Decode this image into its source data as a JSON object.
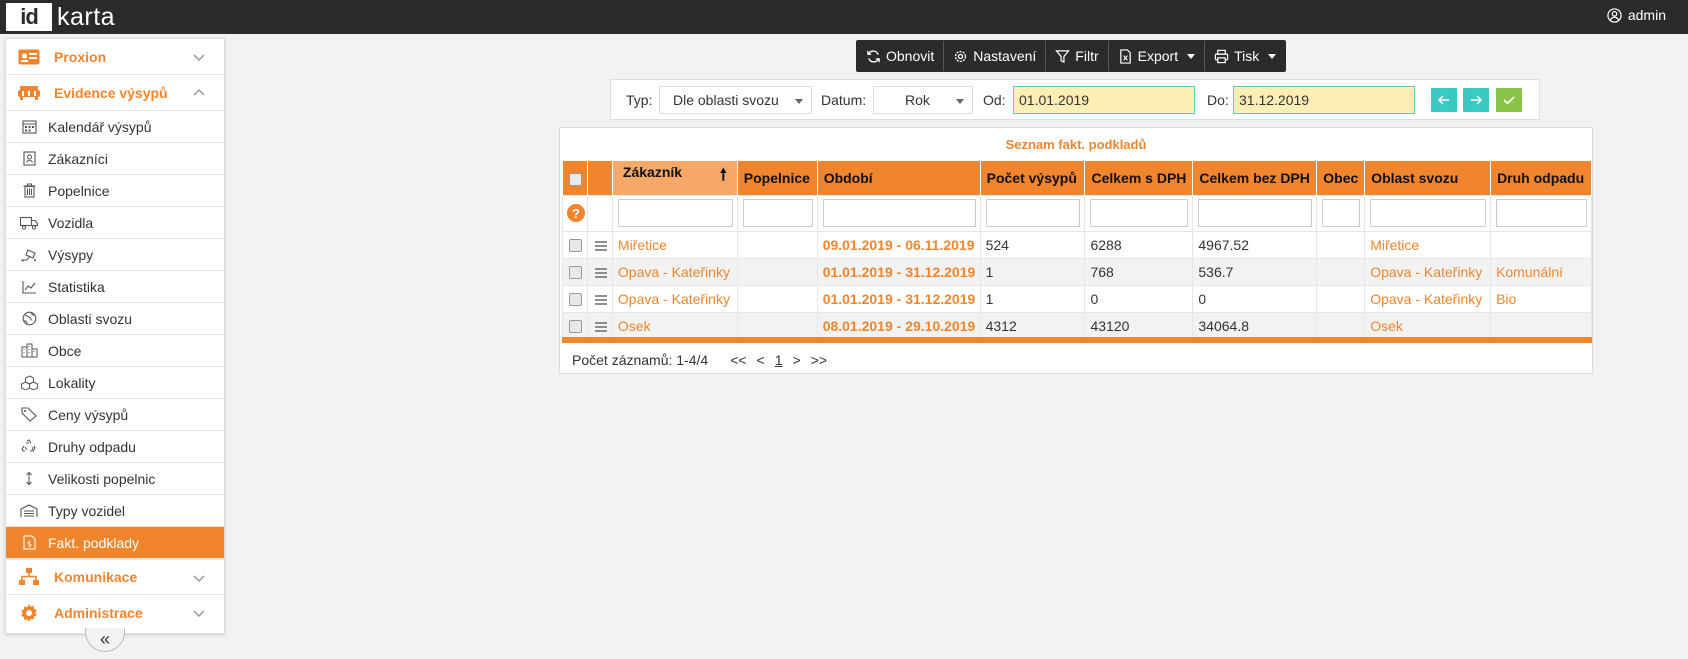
{
  "header": {
    "logo_id": "id",
    "logo_karta": "karta",
    "user_name": "admin"
  },
  "sidebar": {
    "sections": [
      {
        "label": "Proxion",
        "icon": "id-card-icon",
        "expanded": false
      },
      {
        "label": "Evidence výsypů",
        "icon": "sofa-bin-icon",
        "expanded": true
      },
      {
        "label": "Komunikace",
        "icon": "network-icon",
        "expanded": false
      },
      {
        "label": "Administrace",
        "icon": "gear-icon",
        "expanded": false
      }
    ],
    "items": [
      {
        "label": "Kalendář výsypů",
        "icon": "calendar-icon"
      },
      {
        "label": "Zákazníci",
        "icon": "contact-card-icon"
      },
      {
        "label": "Popelnice",
        "icon": "trash-bin-icon"
      },
      {
        "label": "Vozidla",
        "icon": "truck-icon"
      },
      {
        "label": "Výsypy",
        "icon": "dump-icon"
      },
      {
        "label": "Statistika",
        "icon": "chart-line-icon"
      },
      {
        "label": "Oblasti svozu",
        "icon": "globe-icon"
      },
      {
        "label": "Obce",
        "icon": "city-icon"
      },
      {
        "label": "Lokality",
        "icon": "cubes-icon"
      },
      {
        "label": "Ceny výsypů",
        "icon": "tags-icon"
      },
      {
        "label": "Druhy odpadu",
        "icon": "recycle-icon"
      },
      {
        "label": "Velikosti popelnic",
        "icon": "resize-vertical-icon"
      },
      {
        "label": "Typy vozidel",
        "icon": "garage-icon"
      },
      {
        "label": "Fakt. podklady",
        "icon": "invoice-icon",
        "active": true
      }
    ],
    "collapse_label": "«"
  },
  "toolbar": {
    "refresh": "Obnovit",
    "settings": "Nastavení",
    "filter": "Filtr",
    "export": "Export",
    "print": "Tisk"
  },
  "filters": {
    "type_label": "Typ:",
    "type_value": "Dle oblasti svozu",
    "date_label": "Datum:",
    "date_value": "Rok",
    "from_label": "Od:",
    "from_value": "01.01.2019",
    "to_label": "Do:",
    "to_value": "31.12.2019"
  },
  "table": {
    "title": "Seznam fakt. podkladů",
    "columns": [
      "Zákazník",
      "Popelnice",
      "Období",
      "Počet výsypů",
      "Celkem s DPH",
      "Celkem bez DPH",
      "Obec",
      "Oblast svozu",
      "Druh odpadu"
    ],
    "sort_arrow": "🠕",
    "help_label": "?",
    "rows": [
      {
        "zakaznik": "Miřetice",
        "popelnice": "",
        "obdobi": "09.01.2019 - 06.11.2019",
        "pocet": "524",
        "s_dph": "6288",
        "bez_dph": "4967.52",
        "obec": "",
        "oblast": "Miřetice",
        "druh": ""
      },
      {
        "zakaznik": "Opava - Kateřinky",
        "popelnice": "",
        "obdobi": "01.01.2019 - 31.12.2019",
        "pocet": "1",
        "s_dph": "768",
        "bez_dph": "536.7",
        "obec": "",
        "oblast": "Opava - Kateřinky",
        "druh": "Komunální"
      },
      {
        "zakaznik": "Opava - Kateřinky",
        "popelnice": "",
        "obdobi": "01.01.2019 - 31.12.2019",
        "pocet": "1",
        "s_dph": "0",
        "bez_dph": "0",
        "obec": "",
        "oblast": "Opava - Kateřinky",
        "druh": "Bio"
      },
      {
        "zakaznik": "Osek",
        "popelnice": "",
        "obdobi": "08.01.2019 - 29.10.2019",
        "pocet": "4312",
        "s_dph": "43120",
        "bez_dph": "34064.8",
        "obec": "",
        "oblast": "Osek",
        "druh": ""
      }
    ]
  },
  "pager": {
    "records_text": "Počet záznamů: 1-4/4",
    "first": "<<",
    "prev": "<",
    "current": "1",
    "next": ">",
    "last": ">>"
  },
  "colors": {
    "accent": "#f0852d",
    "topbar": "#2b2b2b",
    "date_bg": "#fdeeb5",
    "teal": "#3cc9c3",
    "green": "#8bc34a"
  }
}
